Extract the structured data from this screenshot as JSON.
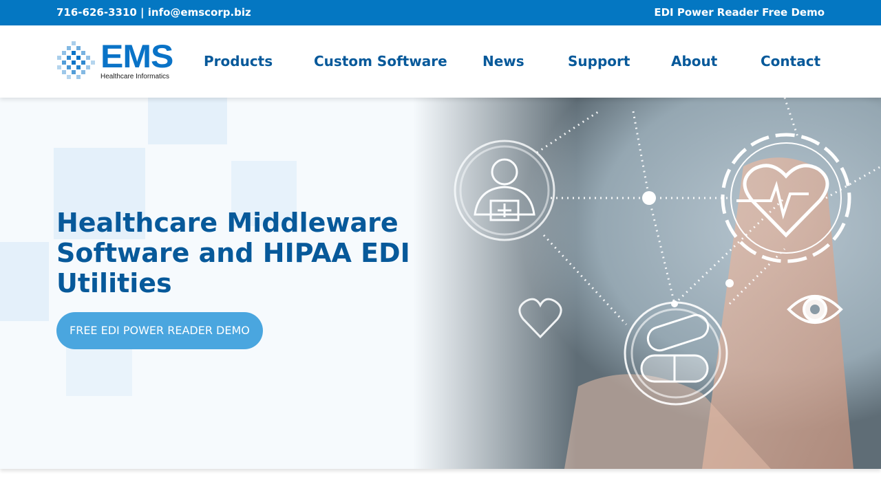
{
  "topbar": {
    "phone": "716-626-3310",
    "separator": " | ",
    "email": "info@emscorp.biz",
    "demo_link": "EDI Power Reader Free Demo"
  },
  "logo": {
    "wordmark": "EMS",
    "tagline": "Healthcare Informatics",
    "alt": "EMS Healthcare Informatics"
  },
  "nav": {
    "items": [
      {
        "label": "Products"
      },
      {
        "label": "Custom Software"
      },
      {
        "label": "News"
      },
      {
        "label": "Support"
      },
      {
        "label": "About"
      },
      {
        "label": "Contact"
      }
    ]
  },
  "hero": {
    "heading": "Healthcare Middleware Software and HIPAA EDI Utilities",
    "cta_label": "FREE EDI POWER READER DEMO"
  },
  "colors": {
    "topbar_bg": "#0477c2",
    "nav_text": "#07599a",
    "heading": "#07599a",
    "cta_bg": "#4aa6df"
  },
  "icons": [
    "logo-pixel-mark-icon",
    "person-medical-icon",
    "heart-pulse-icon",
    "heart-outline-icon",
    "pills-icon",
    "eye-icon"
  ]
}
